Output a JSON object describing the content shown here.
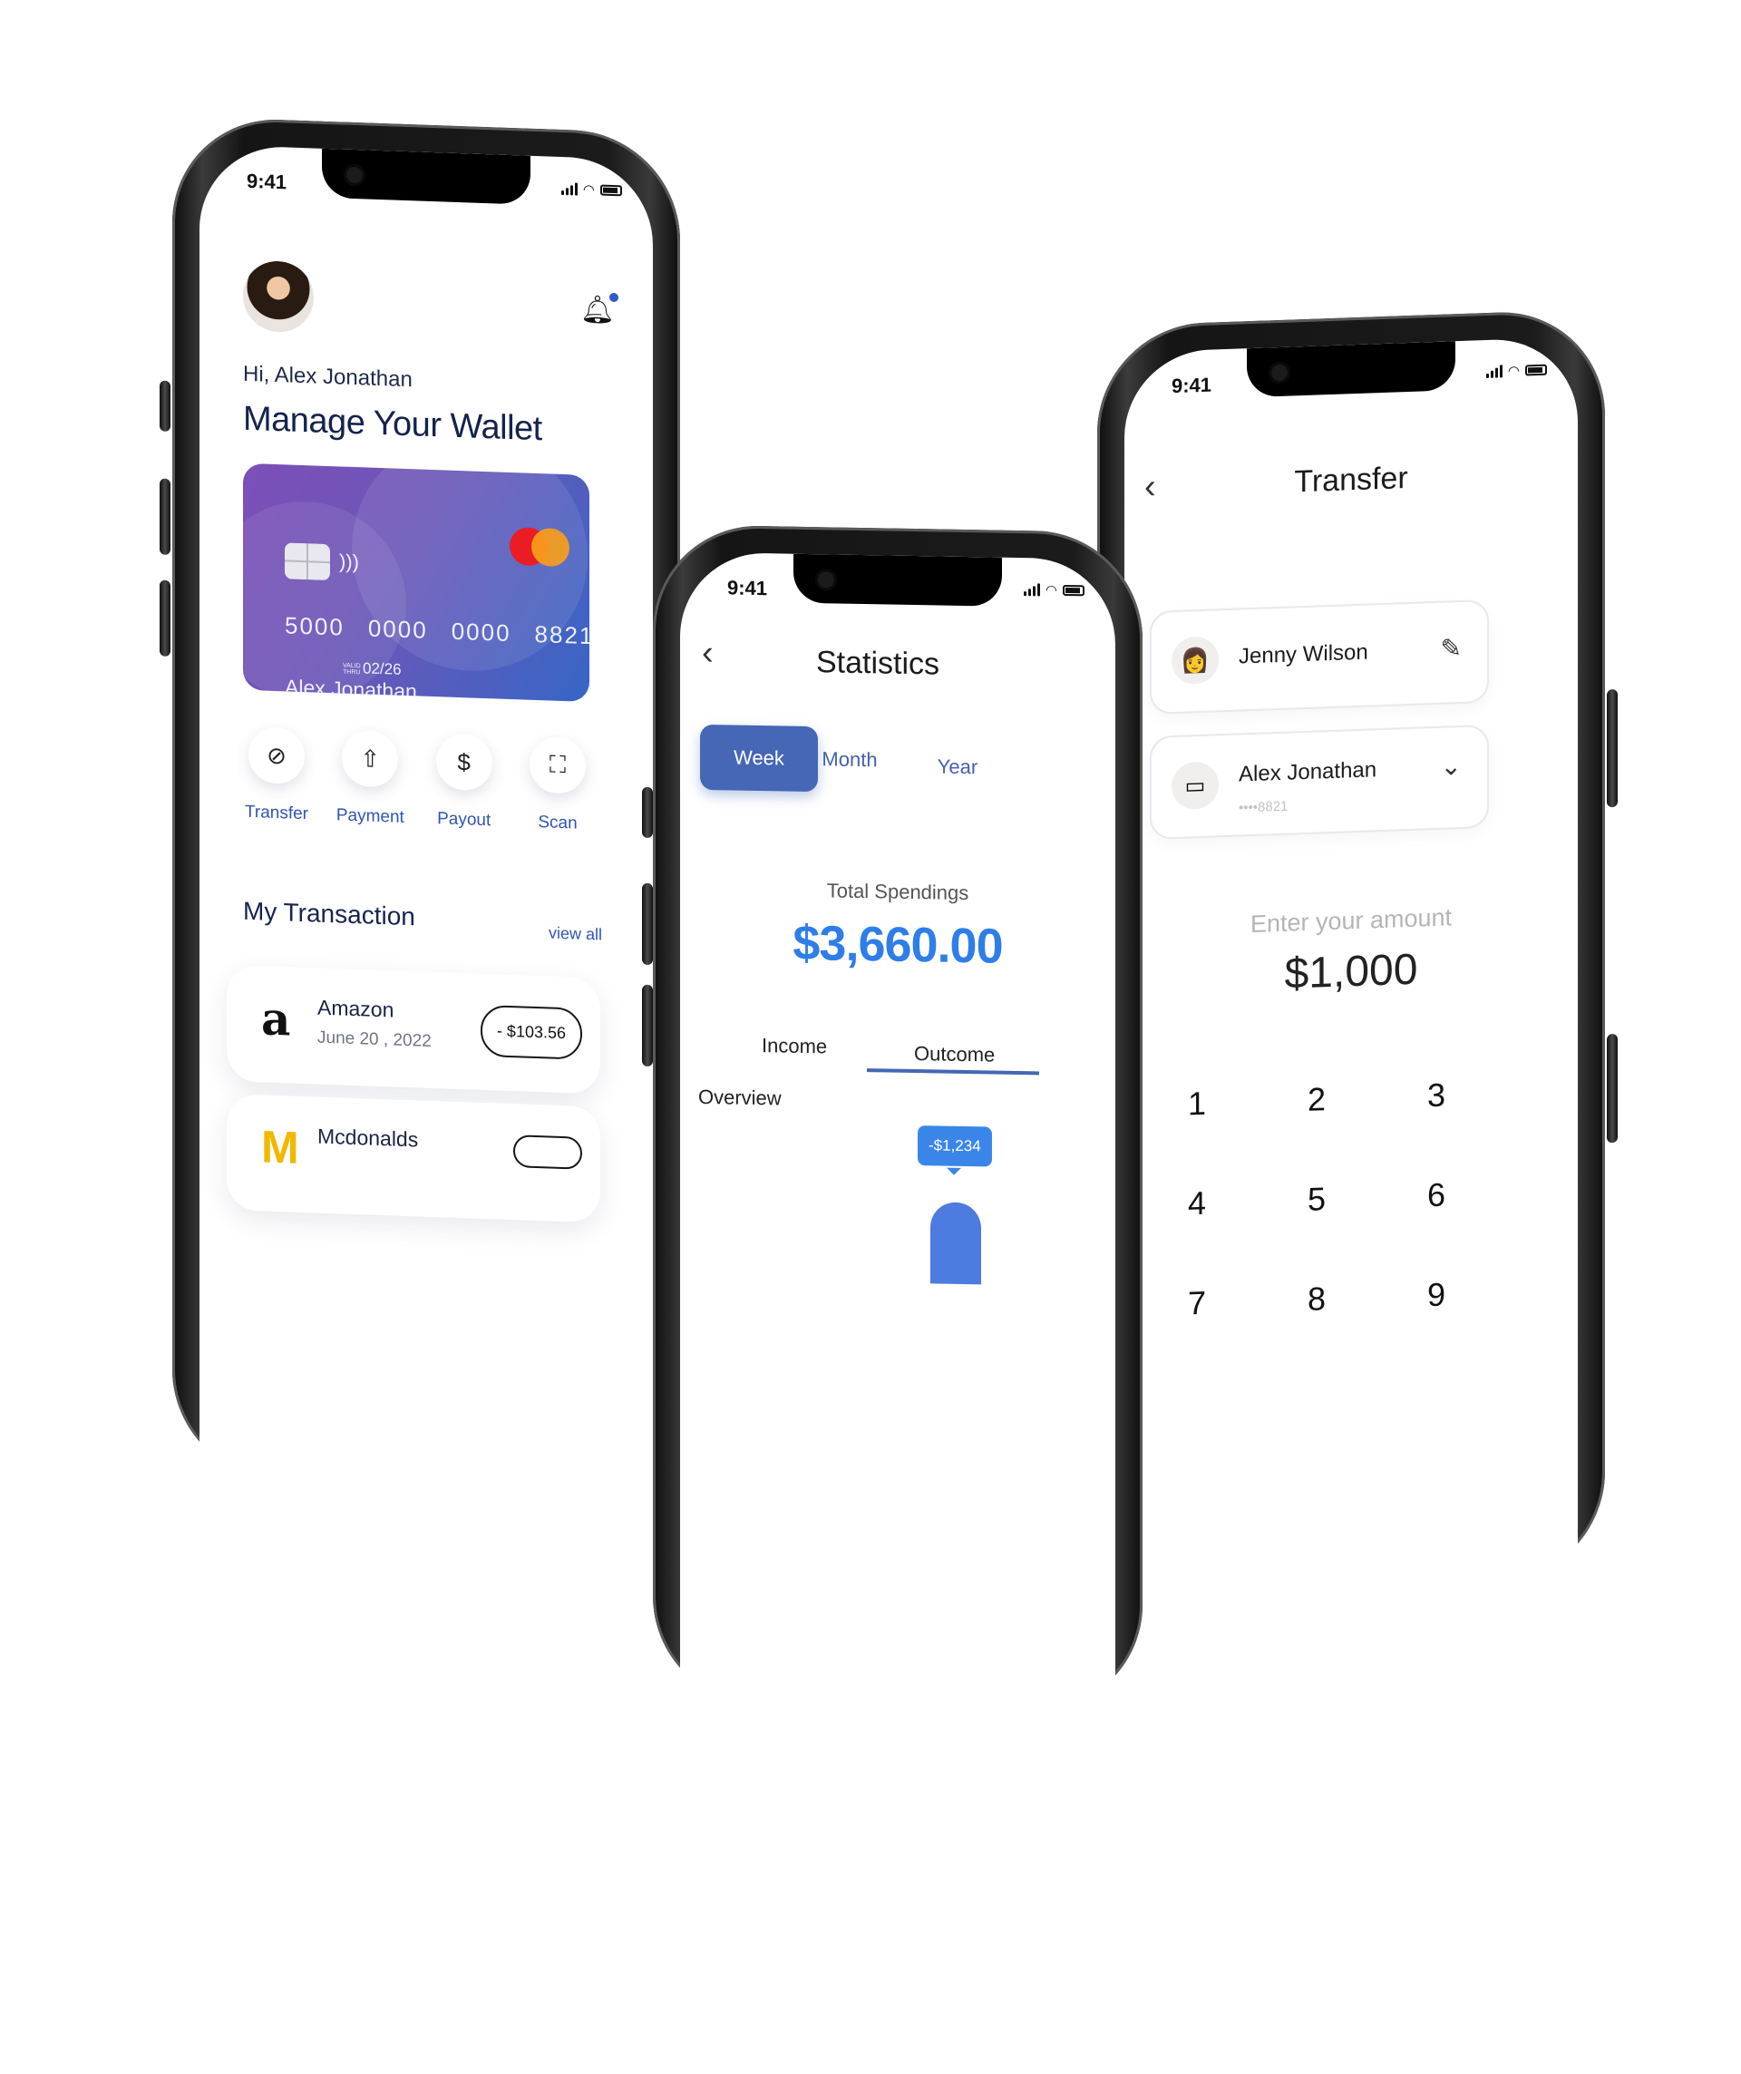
{
  "phones": {
    "wallet": {
      "time": "9:41",
      "greeting": "Hi, Alex Jonathan",
      "headline": "Manage Your Wallet",
      "card": {
        "number_groups": [
          "5000",
          "0000",
          "0000",
          "8821"
        ],
        "valid_caption": "VALID THRU",
        "valid_thru": "02/26",
        "holder": "Alex Jonathan",
        "brand_colors": [
          "#eb1c24",
          "#f79e1b"
        ]
      },
      "actions": [
        {
          "label": "Transfer",
          "icon": "transfer-icon",
          "glyph": "⊘"
        },
        {
          "label": "Payment",
          "icon": "upload-icon",
          "glyph": "⇧"
        },
        {
          "label": "Payout",
          "icon": "payout-icon",
          "glyph": "$"
        },
        {
          "label": "Scan",
          "icon": "scan-icon",
          "glyph": "⛶"
        }
      ],
      "transactions_title": "My Transaction",
      "view_all": "view all",
      "transactions": [
        {
          "logo": "a",
          "name": "Amazon",
          "date": "June 20 , 2022",
          "amount": "- $103.56"
        },
        {
          "logo": "M",
          "name": "Mcdonalds",
          "date": "",
          "amount": ""
        }
      ]
    },
    "statistics": {
      "time": "9:41",
      "title": "Statistics",
      "back": "‹",
      "periods": [
        "Week",
        "Month",
        "Year"
      ],
      "selected_period": "Week",
      "total_label": "Total Spendings",
      "total_value": "$3,660.00",
      "tabs": [
        "Income",
        "Outcome"
      ],
      "selected_tab": "Outcome",
      "overview_label": "Overview",
      "tooltip": "-$1,234",
      "accent": "#4666b6",
      "value_color": "#2f7ee8"
    },
    "transfer": {
      "time": "9:41",
      "title": "Transfer",
      "back": "‹",
      "recipient": {
        "name": "Jenny Wilson",
        "avatar": "👩",
        "action_icon": "✎"
      },
      "source": {
        "name": "Alex Jonathan",
        "masked": "••••8821",
        "icon": "▭",
        "dropdown": "⌄"
      },
      "amount_label": "Enter your amount",
      "amount_value": "$1,000",
      "keypad": [
        "1",
        "2",
        "3",
        "4",
        "5",
        "6",
        "7",
        "8",
        "9"
      ]
    }
  }
}
